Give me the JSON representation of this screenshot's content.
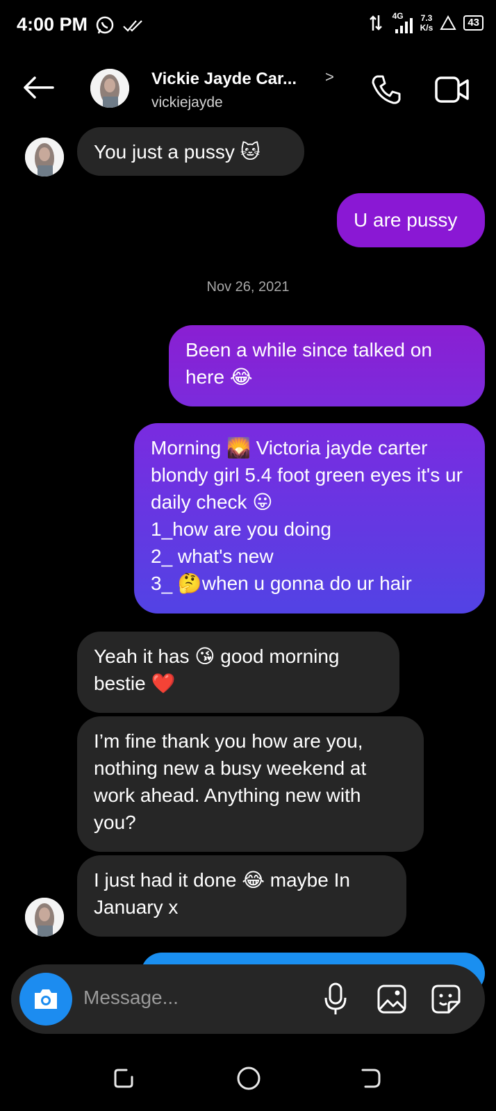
{
  "status_bar": {
    "time": "4:00 PM",
    "network": "4G",
    "speed": "7.3",
    "speed_unit": "K/s",
    "battery": "43"
  },
  "header": {
    "name": "Vickie Jayde Car...",
    "username": "vickiejayde",
    "chevron": ">"
  },
  "messages": [
    {
      "from": "them",
      "text": "You just a pussy 🐱"
    },
    {
      "from": "me",
      "text": "U are pussy"
    },
    {
      "type": "date",
      "text": "Nov 26, 2021"
    },
    {
      "from": "me",
      "text": "Been a while since talked on here 😂"
    },
    {
      "from": "me",
      "text": "Morning 🌄 Victoria jayde carter blondy girl 5.4 foot green eyes it's ur daily check 😛\n1_how are you doing\n2_ what's new\n3_ 🤔when u gonna do ur  hair"
    },
    {
      "from": "them",
      "text": "Yeah it has 😘 good morning bestie ❤️"
    },
    {
      "from": "them",
      "text": "I’m fine thank you how are you, nothing new a busy weekend at work ahead. Anything new with you?"
    },
    {
      "from": "them",
      "text": "I just had it done 😂 maybe In January x"
    }
  ],
  "composer": {
    "placeholder": "Message..."
  },
  "icons": [
    "back-arrow-icon",
    "phone-icon",
    "video-icon",
    "camera-icon",
    "microphone-icon",
    "gallery-icon",
    "sticker-icon",
    "recents-icon",
    "home-icon",
    "back-nav-icon"
  ],
  "colors": {
    "outgoing_purple": "#8a18d4",
    "outgoing_blue": "#5243e4",
    "incoming_gray": "#262626",
    "camera_blue": "#1c8cf0"
  }
}
